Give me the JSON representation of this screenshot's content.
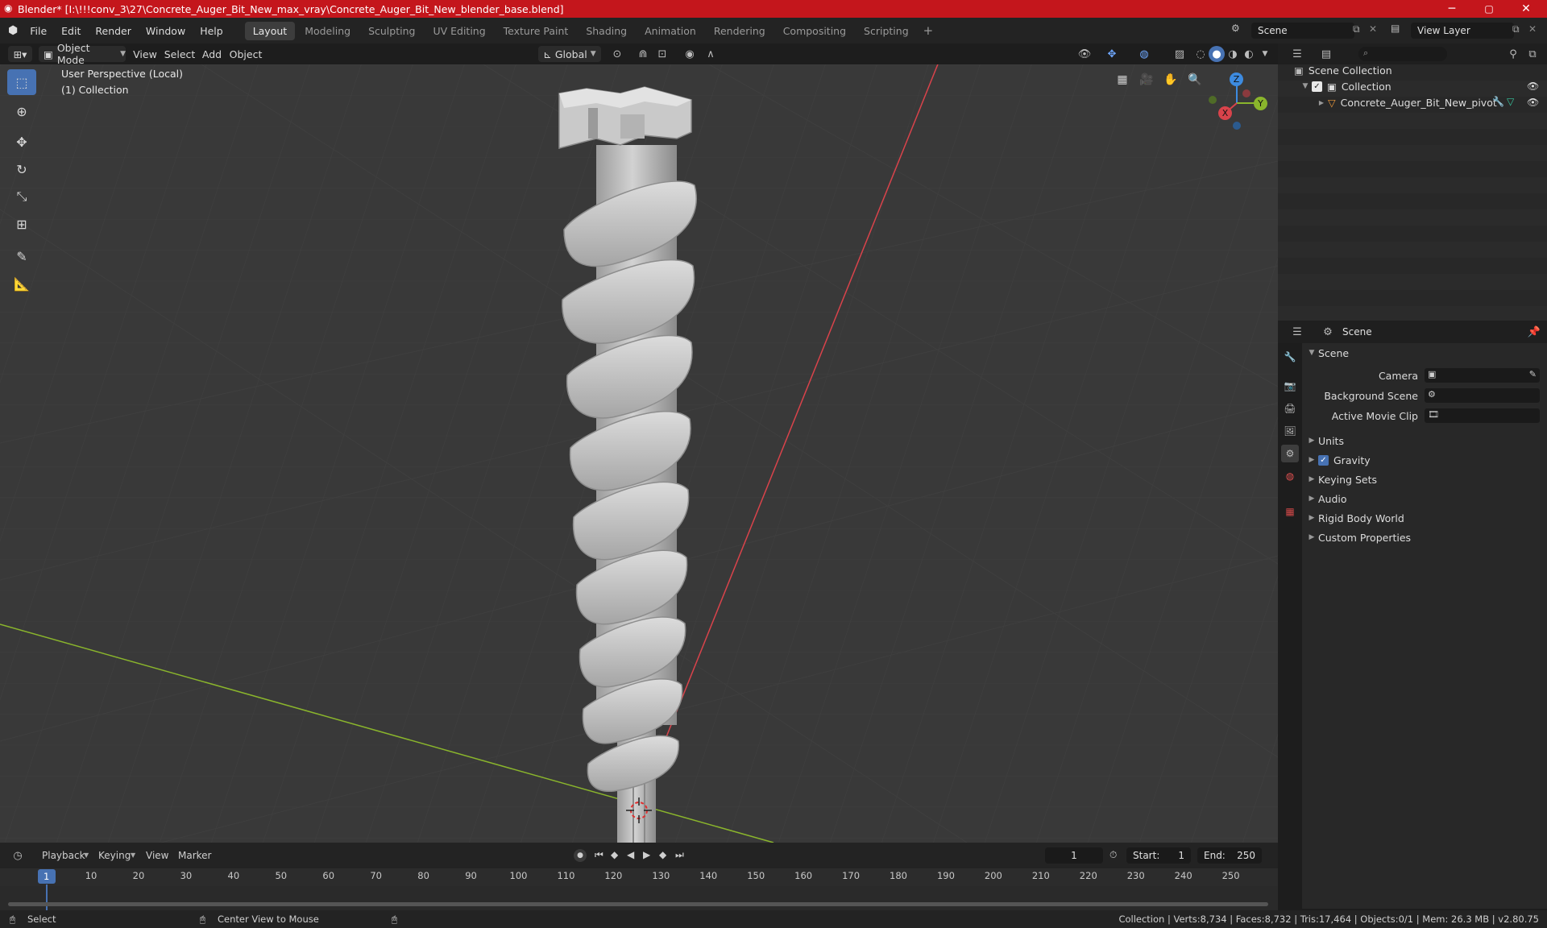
{
  "window": {
    "title": "Blender* [I:\\!!!conv_3\\27\\Concrete_Auger_Bit_New_max_vray\\Concrete_Auger_Bit_New_blender_base.blend]",
    "minimize": "─",
    "maximize": "▢",
    "close": "✕"
  },
  "menu": [
    "File",
    "Edit",
    "Render",
    "Window",
    "Help"
  ],
  "workspaces": [
    "Layout",
    "Modeling",
    "Sculpting",
    "UV Editing",
    "Texture Paint",
    "Shading",
    "Animation",
    "Rendering",
    "Compositing",
    "Scripting"
  ],
  "add_workspace": "+",
  "scene_field": "Scene",
  "view_layer_field": "View Layer",
  "viewport_header": {
    "mode": "Object Mode",
    "menus": [
      "View",
      "Select",
      "Add",
      "Object"
    ],
    "orientation": "Global"
  },
  "viewport_overlay": {
    "perspective": "User Perspective (Local)",
    "collection": "(1) Collection"
  },
  "gizmo": {
    "z": "Z",
    "y": "Y",
    "x": "X"
  },
  "outliner": {
    "root": "Scene Collection",
    "collection": "Collection",
    "object": "Concrete_Auger_Bit_New_pivot"
  },
  "properties": {
    "header": "Scene",
    "section": "Scene",
    "camera_label": "Camera",
    "background_label": "Background Scene",
    "movie_clip_label": "Active Movie Clip",
    "panels": [
      "Units",
      "Gravity",
      "Keying Sets",
      "Audio",
      "Rigid Body World",
      "Custom Properties"
    ]
  },
  "timeline": {
    "menus": [
      "Playback",
      "Keying",
      "View",
      "Marker"
    ],
    "current_frame": "1",
    "start_label": "Start:",
    "start": "1",
    "end_label": "End:",
    "end": "250",
    "ticks": [
      "1",
      "10",
      "20",
      "30",
      "40",
      "50",
      "60",
      "70",
      "80",
      "90",
      "100",
      "110",
      "120",
      "130",
      "140",
      "150",
      "160",
      "170",
      "180",
      "190",
      "200",
      "210",
      "220",
      "230",
      "240",
      "250"
    ]
  },
  "status": {
    "select": "Select",
    "center_view": "Center View to Mouse",
    "stats": "Collection | Verts:8,734 | Faces:8,732 | Tris:17,464 | Objects:0/1 | Mem: 26.3 MB | v2.80.75"
  },
  "colors": {
    "title_bar": "#c4161c",
    "accent": "#4772b3",
    "x_axis": "#d9434b",
    "y_axis": "#8ab52c",
    "z_axis": "#3d8be0"
  }
}
